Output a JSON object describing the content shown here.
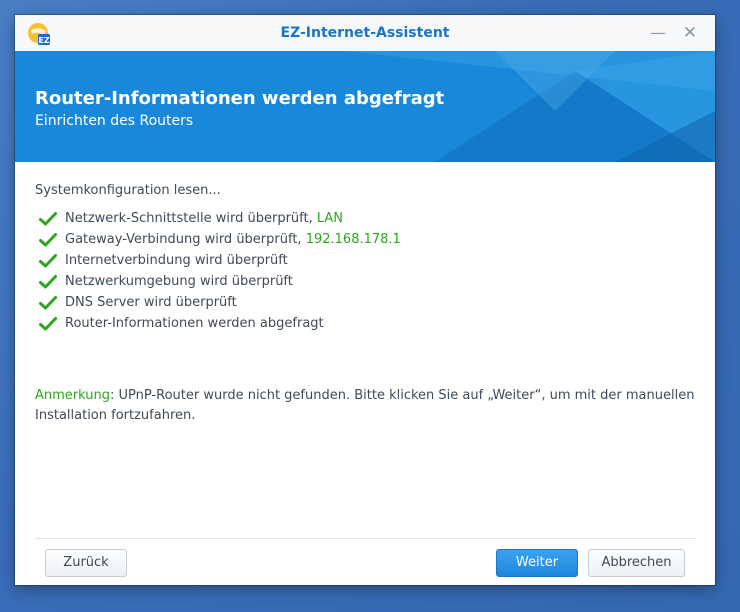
{
  "window": {
    "title": "EZ-Internet-Assistent",
    "icon": "ez-assistant-app-icon",
    "minimize_glyph": "—",
    "close_glyph": "✕"
  },
  "banner": {
    "title": "Router-Informationen werden abgefragt",
    "subtitle": "Einrichten des Routers"
  },
  "content": {
    "status": "Systemkonfiguration lesen...",
    "checks": [
      {
        "label": "Netzwerk-Schnittstelle wird überprüft, ",
        "value": "LAN"
      },
      {
        "label": "Gateway-Verbindung wird überprüft, ",
        "value": "192.168.178.1"
      },
      {
        "label": "Internetverbindung wird überprüft",
        "value": ""
      },
      {
        "label": "Netzwerkumgebung wird überprüft",
        "value": ""
      },
      {
        "label": "DNS Server wird überprüft",
        "value": ""
      },
      {
        "label": "Router-Informationen werden abgefragt",
        "value": ""
      }
    ],
    "note_label": "Anmerkung",
    "note_text": ": UPnP-Router wurde nicht gefunden. Bitte klicken Sie auf „Weiter“, um mit der manuellen Installation fortzufahren."
  },
  "footer": {
    "back_label": "Zurück",
    "next_label": "Weiter",
    "cancel_label": "Abbrechen"
  },
  "colors": {
    "accent": "#1a86d6",
    "title_text": "#1a76c4",
    "success": "#2fa51f"
  }
}
